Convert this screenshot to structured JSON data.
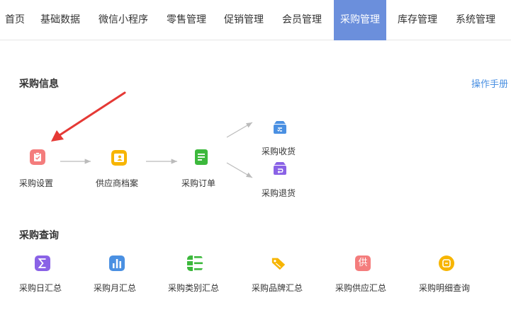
{
  "nav": {
    "items": [
      {
        "label": "首页"
      },
      {
        "label": "基础数据"
      },
      {
        "label": "微信小程序"
      },
      {
        "label": "零售管理"
      },
      {
        "label": "促销管理"
      },
      {
        "label": "会员管理"
      },
      {
        "label": "采购管理",
        "active": true
      },
      {
        "label": "库存管理"
      },
      {
        "label": "系统管理"
      }
    ]
  },
  "info": {
    "title": "采购信息",
    "manual": "操作手册",
    "flow": [
      {
        "label": "采购设置",
        "icon": "clipboard-icon",
        "color": "#f47d7d"
      },
      {
        "label": "供应商档案",
        "icon": "contact-card-icon",
        "color": "#f7b500"
      },
      {
        "label": "采购订单",
        "icon": "document-icon",
        "color": "#3cb83c"
      },
      {
        "label": "采购收货",
        "icon": "receive-box-icon",
        "color": "#4a90e2"
      },
      {
        "label": "采购退货",
        "icon": "return-box-icon",
        "color": "#8a62e6"
      }
    ]
  },
  "query": {
    "title": "采购查询",
    "items": [
      {
        "label": "采购日汇总",
        "icon": "sigma-icon",
        "color": "#8a62e6"
      },
      {
        "label": "采购月汇总",
        "icon": "bar-chart-icon",
        "color": "#4a90e2"
      },
      {
        "label": "采购类别汇总",
        "icon": "list-icon",
        "color": "#3cb83c"
      },
      {
        "label": "采购品牌汇总",
        "icon": "tag-icon",
        "color": "#f7b500"
      },
      {
        "label": "采购供应汇总",
        "icon": "supply-icon",
        "color": "#f47d7d",
        "glyph": "供"
      },
      {
        "label": "采购明细查询",
        "icon": "detail-search-icon",
        "color": "#f7b500"
      }
    ]
  }
}
